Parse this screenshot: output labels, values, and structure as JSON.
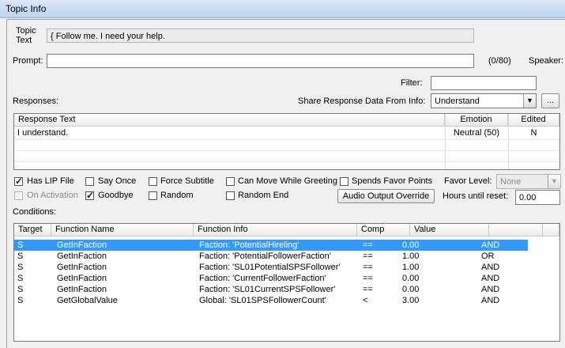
{
  "window": {
    "title": "Topic Info"
  },
  "topic": {
    "label_line1": "Topic",
    "label_line2": "Text",
    "value": "{ Follow me. I need your help."
  },
  "prompt": {
    "label": "Prompt:",
    "value": "",
    "counter": "(0/80)",
    "speaker_label": "Speaker:"
  },
  "filter": {
    "label": "Filter:",
    "value": ""
  },
  "responses": {
    "label": "Responses:",
    "share_label": "Share Response Data From Info:",
    "share_value": "Understand",
    "browse_label": "...",
    "columns": [
      "Response Text",
      "Emotion",
      "Edited"
    ],
    "rows": [
      {
        "text": "I understand.",
        "emotion": "Neutral (50)",
        "edited": "N"
      }
    ]
  },
  "options": {
    "has_lip_file": {
      "label": "Has LIP File",
      "checked": true
    },
    "say_once": {
      "label": "Say Once",
      "checked": false
    },
    "force_subtitle": {
      "label": "Force Subtitle",
      "checked": false
    },
    "can_move_while_greeting": {
      "label": "Can Move While Greeting",
      "checked": false
    },
    "spends_favor_points": {
      "label": "Spends Favor Points",
      "checked": false
    },
    "on_activation": {
      "label": "On Activation",
      "checked": false
    },
    "goodbye": {
      "label": "Goodbye",
      "checked": true
    },
    "random": {
      "label": "Random",
      "checked": false
    },
    "random_end": {
      "label": "Random End",
      "checked": false
    },
    "favor_level_label": "Favor Level:",
    "favor_level_value": "None",
    "audio_output_override": "Audio Output Override",
    "hours_until_reset_label": "Hours until reset:",
    "hours_until_reset_value": "0.00"
  },
  "conditions": {
    "label": "Conditions:",
    "columns": [
      "Target",
      "Function Name",
      "Function Info",
      "Comp",
      "Value",
      ""
    ],
    "rows": [
      {
        "target": "S",
        "function": "GetInFaction",
        "info": "Faction: 'PotentialHireling'",
        "comp": "==",
        "value": "0.00",
        "op": "AND",
        "selected": true
      },
      {
        "target": "S",
        "function": "GetInFaction",
        "info": "Faction: 'PotentialFollowerFaction'",
        "comp": "==",
        "value": "1.00",
        "op": "OR",
        "selected": false
      },
      {
        "target": "S",
        "function": "GetInFaction",
        "info": "Faction: 'SL01PotentialSPSFollower'",
        "comp": "==",
        "value": "1.00",
        "op": "AND",
        "selected": false
      },
      {
        "target": "S",
        "function": "GetInFaction",
        "info": "Faction: 'CurrentFollowerFaction'",
        "comp": "==",
        "value": "0.00",
        "op": "AND",
        "selected": false
      },
      {
        "target": "S",
        "function": "GetInFaction",
        "info": "Faction: 'SL01CurrentSPSFollower'",
        "comp": "==",
        "value": "0.00",
        "op": "AND",
        "selected": false
      },
      {
        "target": "S",
        "function": "GetGlobalValue",
        "info": "Global: 'SL01SPSFollowerCount'",
        "comp": "<",
        "value": "3.00",
        "op": "AND",
        "selected": false
      }
    ]
  }
}
